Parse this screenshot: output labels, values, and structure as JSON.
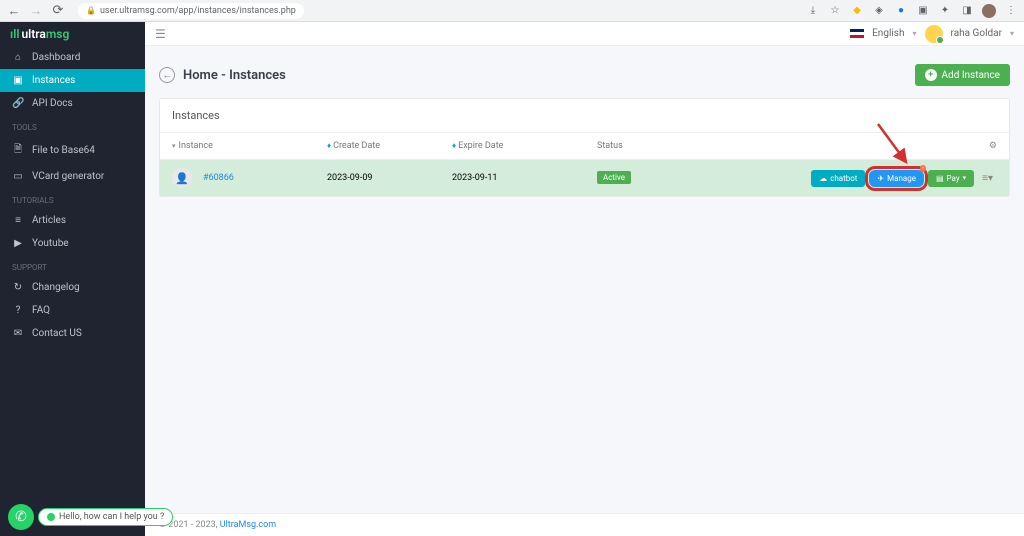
{
  "browser": {
    "url": "user.ultramsg.com/app/instances/instances.php"
  },
  "logo": {
    "brand1": "ultra",
    "brand2": "msg"
  },
  "sidebar": {
    "main": [
      {
        "icon": "⌂",
        "label": "Dashboard"
      },
      {
        "icon": "▣",
        "label": "Instances"
      },
      {
        "icon": "🔗",
        "label": "API Docs"
      }
    ],
    "sections": [
      {
        "title": "TOOLS",
        "items": [
          {
            "icon": "🗎",
            "label": "File to Base64"
          },
          {
            "icon": "▭",
            "label": "VCard generator"
          }
        ]
      },
      {
        "title": "TUTORIALS",
        "items": [
          {
            "icon": "≡",
            "label": "Articles"
          },
          {
            "icon": "▶",
            "label": "Youtube"
          }
        ]
      },
      {
        "title": "SUPPORT",
        "items": [
          {
            "icon": "↻",
            "label": "Changelog"
          },
          {
            "icon": "?",
            "label": "FAQ"
          },
          {
            "icon": "✉",
            "label": "Contact US"
          }
        ]
      }
    ]
  },
  "topbar": {
    "language": "English",
    "username": "raha Goldar"
  },
  "page": {
    "title": "Home - Instances",
    "addBtn": "Add Instance"
  },
  "panel": {
    "title": "Instances",
    "columns": {
      "instance": "Instance",
      "create": "Create Date",
      "expire": "Expire Date",
      "status": "Status"
    },
    "row": {
      "id": "#60866",
      "create": "2023-09-09",
      "expire": "2023-09-11",
      "status": "Active",
      "chatbot": "chatbot",
      "manage": "Manage",
      "pay": "Pay"
    }
  },
  "footer": {
    "copyright": "© 2021 - 2023, ",
    "link": "UltraMsg.com"
  },
  "chat": {
    "text": "Hello, how can I help you ?"
  }
}
